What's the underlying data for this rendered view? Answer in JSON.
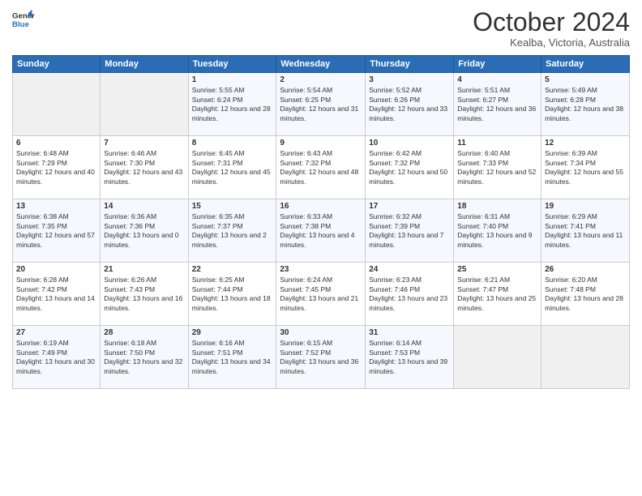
{
  "logo": {
    "line1": "General",
    "line2": "Blue"
  },
  "title": "October 2024",
  "location": "Kealba, Victoria, Australia",
  "weekdays": [
    "Sunday",
    "Monday",
    "Tuesday",
    "Wednesday",
    "Thursday",
    "Friday",
    "Saturday"
  ],
  "weeks": [
    [
      {
        "day": "",
        "sunrise": "",
        "sunset": "",
        "daylight": ""
      },
      {
        "day": "",
        "sunrise": "",
        "sunset": "",
        "daylight": ""
      },
      {
        "day": "1",
        "sunrise": "Sunrise: 5:55 AM",
        "sunset": "Sunset: 6:24 PM",
        "daylight": "Daylight: 12 hours and 28 minutes."
      },
      {
        "day": "2",
        "sunrise": "Sunrise: 5:54 AM",
        "sunset": "Sunset: 6:25 PM",
        "daylight": "Daylight: 12 hours and 31 minutes."
      },
      {
        "day": "3",
        "sunrise": "Sunrise: 5:52 AM",
        "sunset": "Sunset: 6:26 PM",
        "daylight": "Daylight: 12 hours and 33 minutes."
      },
      {
        "day": "4",
        "sunrise": "Sunrise: 5:51 AM",
        "sunset": "Sunset: 6:27 PM",
        "daylight": "Daylight: 12 hours and 36 minutes."
      },
      {
        "day": "5",
        "sunrise": "Sunrise: 5:49 AM",
        "sunset": "Sunset: 6:28 PM",
        "daylight": "Daylight: 12 hours and 38 minutes."
      }
    ],
    [
      {
        "day": "6",
        "sunrise": "Sunrise: 6:48 AM",
        "sunset": "Sunset: 7:29 PM",
        "daylight": "Daylight: 12 hours and 40 minutes."
      },
      {
        "day": "7",
        "sunrise": "Sunrise: 6:46 AM",
        "sunset": "Sunset: 7:30 PM",
        "daylight": "Daylight: 12 hours and 43 minutes."
      },
      {
        "day": "8",
        "sunrise": "Sunrise: 6:45 AM",
        "sunset": "Sunset: 7:31 PM",
        "daylight": "Daylight: 12 hours and 45 minutes."
      },
      {
        "day": "9",
        "sunrise": "Sunrise: 6:43 AM",
        "sunset": "Sunset: 7:32 PM",
        "daylight": "Daylight: 12 hours and 48 minutes."
      },
      {
        "day": "10",
        "sunrise": "Sunrise: 6:42 AM",
        "sunset": "Sunset: 7:32 PM",
        "daylight": "Daylight: 12 hours and 50 minutes."
      },
      {
        "day": "11",
        "sunrise": "Sunrise: 6:40 AM",
        "sunset": "Sunset: 7:33 PM",
        "daylight": "Daylight: 12 hours and 52 minutes."
      },
      {
        "day": "12",
        "sunrise": "Sunrise: 6:39 AM",
        "sunset": "Sunset: 7:34 PM",
        "daylight": "Daylight: 12 hours and 55 minutes."
      }
    ],
    [
      {
        "day": "13",
        "sunrise": "Sunrise: 6:38 AM",
        "sunset": "Sunset: 7:35 PM",
        "daylight": "Daylight: 12 hours and 57 minutes."
      },
      {
        "day": "14",
        "sunrise": "Sunrise: 6:36 AM",
        "sunset": "Sunset: 7:36 PM",
        "daylight": "Daylight: 13 hours and 0 minutes."
      },
      {
        "day": "15",
        "sunrise": "Sunrise: 6:35 AM",
        "sunset": "Sunset: 7:37 PM",
        "daylight": "Daylight: 13 hours and 2 minutes."
      },
      {
        "day": "16",
        "sunrise": "Sunrise: 6:33 AM",
        "sunset": "Sunset: 7:38 PM",
        "daylight": "Daylight: 13 hours and 4 minutes."
      },
      {
        "day": "17",
        "sunrise": "Sunrise: 6:32 AM",
        "sunset": "Sunset: 7:39 PM",
        "daylight": "Daylight: 13 hours and 7 minutes."
      },
      {
        "day": "18",
        "sunrise": "Sunrise: 6:31 AM",
        "sunset": "Sunset: 7:40 PM",
        "daylight": "Daylight: 13 hours and 9 minutes."
      },
      {
        "day": "19",
        "sunrise": "Sunrise: 6:29 AM",
        "sunset": "Sunset: 7:41 PM",
        "daylight": "Daylight: 13 hours and 11 minutes."
      }
    ],
    [
      {
        "day": "20",
        "sunrise": "Sunrise: 6:28 AM",
        "sunset": "Sunset: 7:42 PM",
        "daylight": "Daylight: 13 hours and 14 minutes."
      },
      {
        "day": "21",
        "sunrise": "Sunrise: 6:26 AM",
        "sunset": "Sunset: 7:43 PM",
        "daylight": "Daylight: 13 hours and 16 minutes."
      },
      {
        "day": "22",
        "sunrise": "Sunrise: 6:25 AM",
        "sunset": "Sunset: 7:44 PM",
        "daylight": "Daylight: 13 hours and 18 minutes."
      },
      {
        "day": "23",
        "sunrise": "Sunrise: 6:24 AM",
        "sunset": "Sunset: 7:45 PM",
        "daylight": "Daylight: 13 hours and 21 minutes."
      },
      {
        "day": "24",
        "sunrise": "Sunrise: 6:23 AM",
        "sunset": "Sunset: 7:46 PM",
        "daylight": "Daylight: 13 hours and 23 minutes."
      },
      {
        "day": "25",
        "sunrise": "Sunrise: 6:21 AM",
        "sunset": "Sunset: 7:47 PM",
        "daylight": "Daylight: 13 hours and 25 minutes."
      },
      {
        "day": "26",
        "sunrise": "Sunrise: 6:20 AM",
        "sunset": "Sunset: 7:48 PM",
        "daylight": "Daylight: 13 hours and 28 minutes."
      }
    ],
    [
      {
        "day": "27",
        "sunrise": "Sunrise: 6:19 AM",
        "sunset": "Sunset: 7:49 PM",
        "daylight": "Daylight: 13 hours and 30 minutes."
      },
      {
        "day": "28",
        "sunrise": "Sunrise: 6:18 AM",
        "sunset": "Sunset: 7:50 PM",
        "daylight": "Daylight: 13 hours and 32 minutes."
      },
      {
        "day": "29",
        "sunrise": "Sunrise: 6:16 AM",
        "sunset": "Sunset: 7:51 PM",
        "daylight": "Daylight: 13 hours and 34 minutes."
      },
      {
        "day": "30",
        "sunrise": "Sunrise: 6:15 AM",
        "sunset": "Sunset: 7:52 PM",
        "daylight": "Daylight: 13 hours and 36 minutes."
      },
      {
        "day": "31",
        "sunrise": "Sunrise: 6:14 AM",
        "sunset": "Sunset: 7:53 PM",
        "daylight": "Daylight: 13 hours and 39 minutes."
      },
      {
        "day": "",
        "sunrise": "",
        "sunset": "",
        "daylight": ""
      },
      {
        "day": "",
        "sunrise": "",
        "sunset": "",
        "daylight": ""
      }
    ]
  ]
}
